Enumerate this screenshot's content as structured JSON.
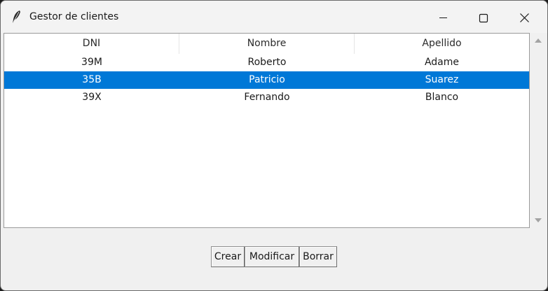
{
  "window": {
    "title": "Gestor de clientes",
    "icon": "feather-icon",
    "controls": [
      "minimize-icon",
      "maximize-icon",
      "close-icon"
    ]
  },
  "table": {
    "columns": [
      "DNI",
      "Nombre",
      "Apellido"
    ],
    "rows": [
      [
        "39M",
        "Roberto",
        "Adame"
      ],
      [
        "35B",
        "Patricio",
        "Suarez"
      ],
      [
        "39X",
        "Fernando",
        "Blanco"
      ]
    ],
    "selected_row": 1,
    "selection_color": "#0078d7"
  },
  "buttons": {
    "crear": "Crear",
    "modificar": "Modificar",
    "borrar": "Borrar"
  }
}
